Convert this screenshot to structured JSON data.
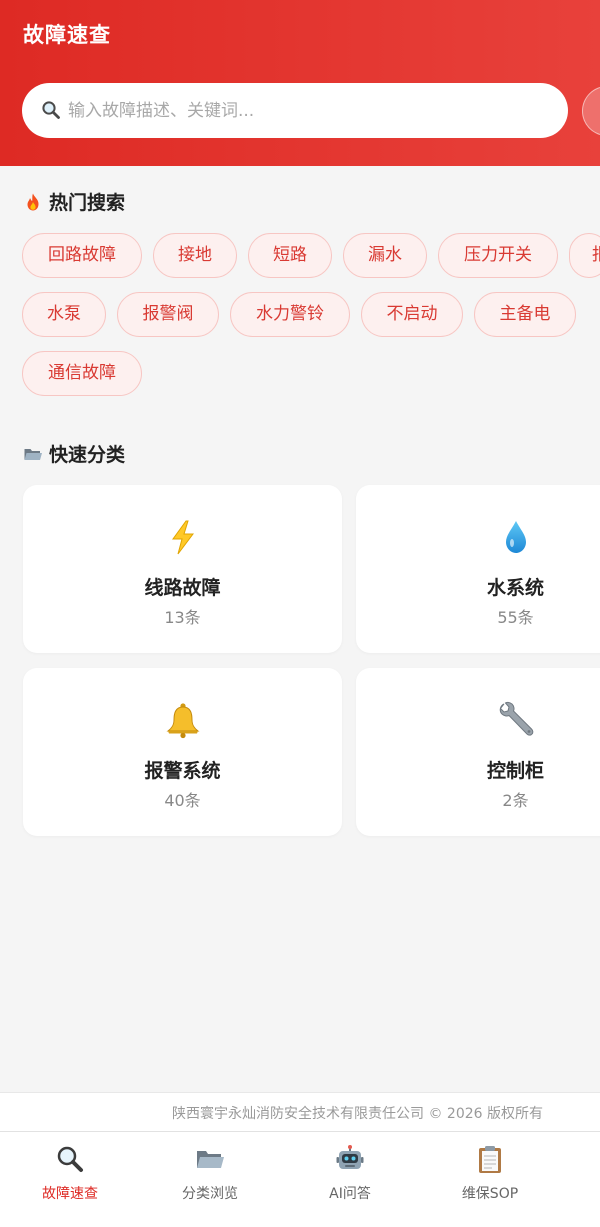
{
  "header": {
    "title": "故障速查",
    "search_placeholder": "输入故障描述、关键词..."
  },
  "hot_search": {
    "title": "热门搜索",
    "icon": "fire-icon",
    "tags": [
      "回路故障",
      "接地",
      "短路",
      "漏水",
      "压力开关",
      "报",
      "水泵",
      "报警阀",
      "水力警铃",
      "不启动",
      "主备电",
      "通信故障"
    ]
  },
  "quick_category": {
    "title": "快速分类",
    "icon": "folder-icon",
    "cards": [
      {
        "name": "线路故障",
        "count": "13条",
        "icon": "lightning-icon"
      },
      {
        "name": "水系统",
        "count": "55条",
        "icon": "water-drop-icon"
      },
      {
        "name": "报警系统",
        "count": "40条",
        "icon": "bell-icon"
      },
      {
        "name": "控制柜",
        "count": "2条",
        "icon": "wrench-icon"
      }
    ]
  },
  "footer": {
    "copyright": "陕西寰宇永灿消防安全技术有限责任公司 © 2026 版权所有"
  },
  "tabbar": {
    "items": [
      {
        "label": "故障速查",
        "icon": "magnifier-icon",
        "active": true
      },
      {
        "label": "分类浏览",
        "icon": "folder-icon",
        "active": false
      },
      {
        "label": "AI问答",
        "icon": "robot-icon",
        "active": false
      },
      {
        "label": "维保SOP",
        "icon": "clipboard-icon",
        "active": false
      }
    ]
  },
  "colors": {
    "brand_red": "#de2a24",
    "tag_border": "#f7c6c3",
    "tag_bg": "#fdf0ef",
    "tag_text": "#d93a33",
    "page_bg": "#f5f5f5"
  }
}
